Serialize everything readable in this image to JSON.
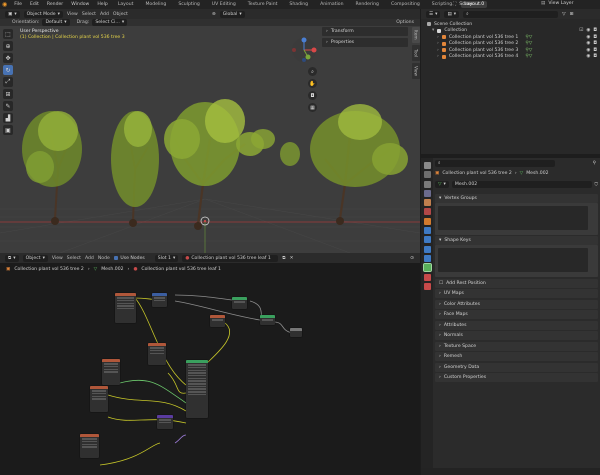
{
  "menu": {
    "items": [
      "File",
      "Edit",
      "Render",
      "Window",
      "Help"
    ],
    "workspaces": [
      "Layout",
      "Modeling",
      "Sculpting",
      "UV Editing",
      "Texture Paint",
      "Shading",
      "Animation",
      "Rendering",
      "Compositing",
      "Scripting",
      "Layout.0"
    ],
    "active_workspace": "Layout.0",
    "scene": "Scene",
    "view_layer": "View Layer"
  },
  "viewport": {
    "mode": "Object Mode",
    "menus": [
      "View",
      "Select",
      "Add",
      "Object"
    ],
    "orientation_label": "Orientation:",
    "orientation": "Default",
    "drag_label": "Drag:",
    "drag": "Select Ci...",
    "transform_pivot": "Global",
    "options": "Options",
    "info_line1": "User Perspective",
    "info_line2": "(1) Collection | Collection plant vol 536 tree 3",
    "npanel": [
      "Transform",
      "Properties"
    ],
    "side_tabs": [
      "Item",
      "Tool",
      "View"
    ]
  },
  "outliner": {
    "rows": [
      {
        "label": "Scene Collection",
        "indent": 0
      },
      {
        "label": "Collection",
        "indent": 1
      },
      {
        "label": "Collection plant vol 536 tree 1",
        "indent": 2
      },
      {
        "label": "Collection plant vol 536 tree 2",
        "indent": 2
      },
      {
        "label": "Collection plant vol 536 tree 3",
        "indent": 2
      },
      {
        "label": "Collection plant vol 536 tree 4",
        "indent": 2
      }
    ]
  },
  "properties": {
    "breadcrumb_object": "Collection plant vol 536 tree 2",
    "breadcrumb_mesh": "Mesh.002",
    "mesh_name": "Mesh.002",
    "panels_open": [
      "Vertex Groups",
      "Shape Keys"
    ],
    "panels_closed": [
      "Add Rest Position",
      "UV Maps",
      "Color Attributes",
      "Face Maps",
      "Attributes",
      "Normals",
      "Texture Space",
      "Remesh",
      "Geometry Data",
      "Custom Properties"
    ]
  },
  "node_editor": {
    "editor_type": "Object",
    "menus": [
      "View",
      "Select",
      "Add",
      "Node"
    ],
    "use_nodes": "Use Nodes",
    "slot": "Slot 1",
    "material": "Collection plant vol 536 tree leaf 1",
    "bread_object": "Collection plant vol 536 tree 2",
    "bread_mesh": "Mesh.002",
    "bread_material": "Collection plant vol 536 tree leaf 1"
  },
  "colors": {
    "accent": "#4772b3",
    "leaf": "#8aa732",
    "trunk": "#4a3526",
    "grid_red": "#b33b3b"
  }
}
